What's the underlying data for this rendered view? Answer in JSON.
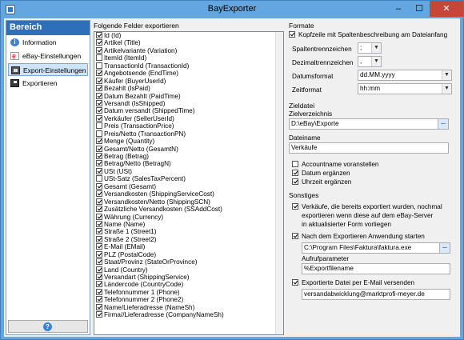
{
  "window": {
    "title": "BayExporter",
    "minimize": "–",
    "maximize": "☐",
    "close": "✕"
  },
  "sidebar": {
    "header": "Bereich",
    "items": [
      {
        "label": "Information",
        "icon": "info-icon"
      },
      {
        "label": "eBay-Einstellungen",
        "icon": "ebay-icon"
      },
      {
        "label": "Export-Einstellungen",
        "icon": "export-settings-icon",
        "active": true
      },
      {
        "label": "Exportieren",
        "icon": "export-run-icon"
      }
    ],
    "help": "?"
  },
  "fields": {
    "heading": "Folgende Felder exportieren",
    "items": [
      {
        "label": "Id (Id)",
        "checked": true
      },
      {
        "label": "Artikel (Title)",
        "checked": true
      },
      {
        "label": "Artikelvariante (Variation)",
        "checked": true
      },
      {
        "label": "ItemId (ItemId)",
        "checked": false
      },
      {
        "label": "TransactionId (TransactionId)",
        "checked": false
      },
      {
        "label": "Angebotsende (EndTime)",
        "checked": true
      },
      {
        "label": "Käufer (BuyerUserId)",
        "checked": true
      },
      {
        "label": "Bezahlt (IsPaid)",
        "checked": true
      },
      {
        "label": "Datum Bezahlt (PaidTime)",
        "checked": true
      },
      {
        "label": "Versandt (IsShipped)",
        "checked": true
      },
      {
        "label": "Datum versandt (ShippedTime)",
        "checked": true
      },
      {
        "label": "Verkäufer (SellerUserId)",
        "checked": true
      },
      {
        "label": "Preis (TransactionPrice)",
        "checked": false
      },
      {
        "label": "Preis/Netto (TransactionPN)",
        "checked": false
      },
      {
        "label": "Menge (Quantity)",
        "checked": true
      },
      {
        "label": "Gesamt/Netto (GesamtN)",
        "checked": true
      },
      {
        "label": "Betrag (Betrag)",
        "checked": true
      },
      {
        "label": "Betrag/Netto (BetragN)",
        "checked": true
      },
      {
        "label": "USt (USt)",
        "checked": true
      },
      {
        "label": "USt-Satz (SalesTaxPercent)",
        "checked": false
      },
      {
        "label": "Gesamt (Gesamt)",
        "checked": true
      },
      {
        "label": "Versandkosten (ShippingServiceCost)",
        "checked": true
      },
      {
        "label": "Versandkosten/Netto (ShippingSCN)",
        "checked": true
      },
      {
        "label": "Zusätzliche Versandkosten (SSAddCost)",
        "checked": true
      },
      {
        "label": "Währung (Currency)",
        "checked": true
      },
      {
        "label": "Name (Name)",
        "checked": true
      },
      {
        "label": "Straße 1 (Street1)",
        "checked": true
      },
      {
        "label": "Straße 2 (Street2)",
        "checked": true
      },
      {
        "label": "E-Mail (EMail)",
        "checked": true
      },
      {
        "label": "PLZ (PostalCode)",
        "checked": true
      },
      {
        "label": "Staat/Provinz (StateOrProvince)",
        "checked": true
      },
      {
        "label": "Land (Country)",
        "checked": true
      },
      {
        "label": "Versandart (ShippingService)",
        "checked": true
      },
      {
        "label": "Ländercode (CountryCode)",
        "checked": true
      },
      {
        "label": "Telefonnummer 1 (Phone)",
        "checked": true
      },
      {
        "label": "Telefonnummer 2 (Phone2)",
        "checked": true
      },
      {
        "label": "Name/Lieferadresse (NameSh)",
        "checked": true
      },
      {
        "label": "Firma//Lieferadresse (CompanyNameSh)",
        "checked": true
      }
    ]
  },
  "formate": {
    "heading": "Formate",
    "header_row_label": "Kopfzeile mit Spaltenbeschreibung am Dateianfang",
    "header_row_checked": true,
    "column_sep_label": "Spaltentrennzeichen",
    "column_sep_value": ";",
    "decimal_sep_label": "Dezimaltrennzeichen",
    "decimal_sep_value": ",",
    "date_format_label": "Datumsformat",
    "date_format_value": "dd.MM.yyyy",
    "time_format_label": "Zeitformat",
    "time_format_value": "hh:mm"
  },
  "zieldatei": {
    "heading": "Zieldatei",
    "dir_label": "Zielverzeichnis",
    "dir_value": "D:\\eBay\\Exporte",
    "filename_label": "Dateiname",
    "filename_value": "Verkäufe",
    "opt_account_label": "Accountname voranstellen",
    "opt_account_checked": false,
    "opt_date_label": "Datum ergänzen",
    "opt_date_checked": true,
    "opt_time_label": "Uhrzeit ergänzen",
    "opt_time_checked": true
  },
  "sonstiges": {
    "heading": "Sonstiges",
    "reexport_line1": "Verkäufe, die bereits exportiert wurden, nochmal",
    "reexport_line2": "exportieren wenn diese auf dem eBay-Server",
    "reexport_line3": "in aktualisierter Form vorliegen",
    "reexport_checked": true,
    "launch_label": "Nach dem Exportieren Anwendung starten",
    "launch_checked": true,
    "launch_path": "C:\\Program Files\\Faktura\\faktura.exe",
    "param_label": "Aufrufparameter",
    "param_value": "%Exportfilename",
    "mail_label": "Exportierte Datei per E-Mail versenden",
    "mail_checked": true,
    "mail_value": "versandabwicklung@marktprofi-meyer.de"
  },
  "icons": {
    "dropdown": "▼",
    "browse": "..."
  }
}
